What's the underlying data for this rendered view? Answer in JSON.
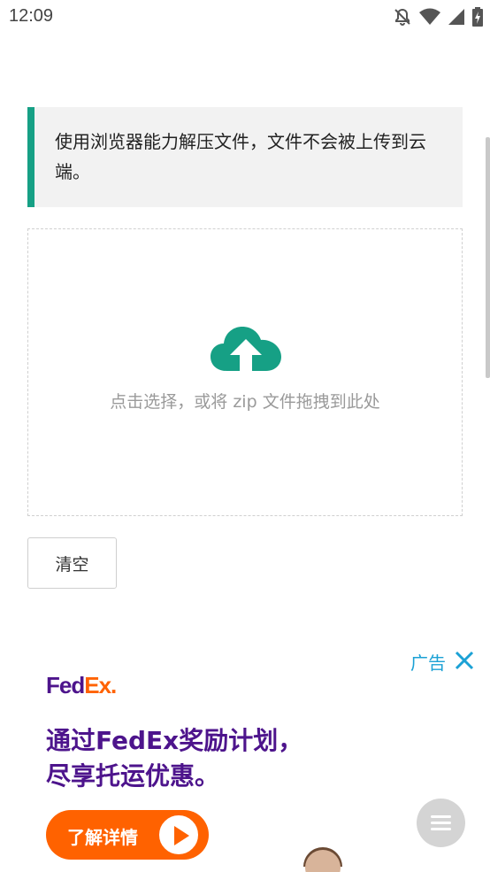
{
  "status_bar": {
    "time": "12:09",
    "icons": [
      "notifications-off-icon",
      "wifi-icon",
      "cellular-signal-icon",
      "battery-charging-icon"
    ]
  },
  "notice": {
    "text": "使用浏览器能力解压文件，文件不会被上传到云端。",
    "accent_color": "#16a085"
  },
  "dropzone": {
    "icon": "cloud-upload-icon",
    "icon_color": "#16a085",
    "label": "点击选择，或将 zip 文件拖拽到此处"
  },
  "actions": {
    "clear_label": "清空"
  },
  "ad": {
    "label": "广告",
    "close_icon": "close-icon",
    "brand_fed": "Fed",
    "brand_ex": "Ex",
    "brand_dot": ".",
    "headline_line1": "通过FedEx奖励计划，",
    "headline_line2": "尽享托运优惠。",
    "cta_label": "了解详情",
    "brand_colors": {
      "purple": "#4d148c",
      "orange": "#ff6200"
    }
  },
  "fab": {
    "icon": "menu-icon"
  }
}
